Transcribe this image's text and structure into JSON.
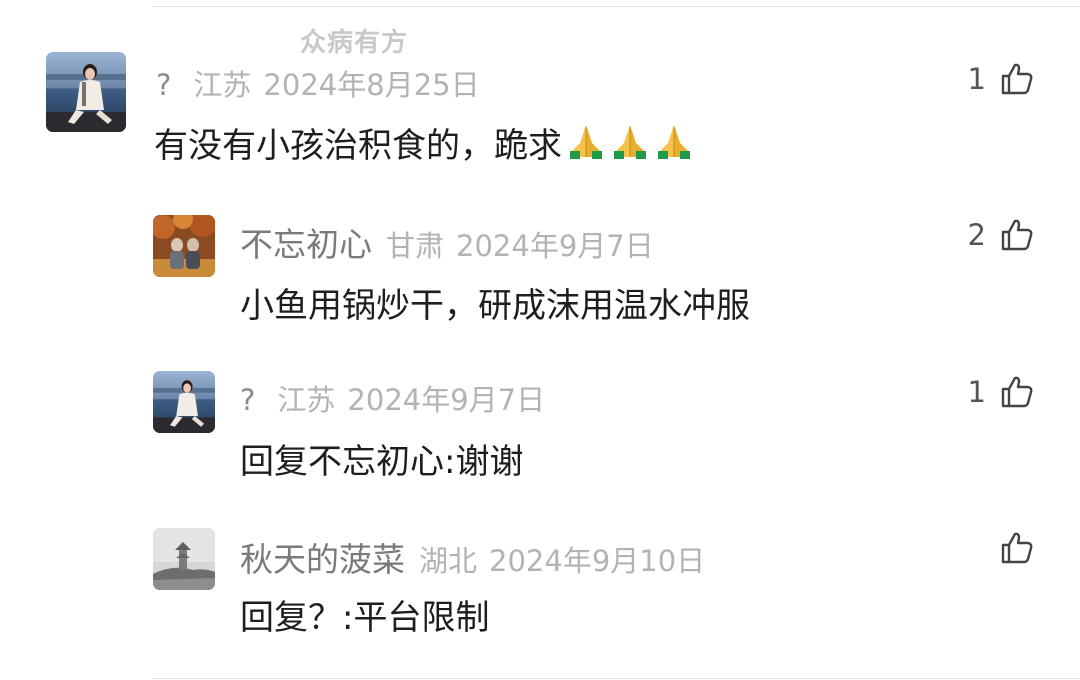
{
  "watermark": "众病有方",
  "colors": {
    "username": "#7a7a7a",
    "meta": "#b3b3b3",
    "text": "#1e1e1e",
    "count": "#555555"
  },
  "comments": [
    {
      "avatar_icon": "avatar-photo-woman-icon",
      "username": "?",
      "region": "江苏",
      "date": "2024年8月25日",
      "text": "有没有小孩治积食的，跪求",
      "emoji": "praying-hands-icon",
      "emoji_count": 3,
      "likes": "1"
    },
    {
      "avatar_icon": "avatar-photo-autumn-icon",
      "username": "不忘初心",
      "region": "甘肃",
      "date": "2024年9月7日",
      "text": "小鱼用锅炒干，研成沫用温水冲服",
      "likes": "2"
    },
    {
      "avatar_icon": "avatar-photo-woman-icon",
      "username": "?",
      "region": "江苏",
      "date": "2024年9月7日",
      "text": "回复不忘初心:谢谢",
      "likes": "1"
    },
    {
      "avatar_icon": "avatar-photo-pagoda-icon",
      "username": "秋天的菠菜",
      "region": "湖北",
      "date": "2024年9月10日",
      "text": "回复？:平台限制",
      "likes": ""
    }
  ]
}
